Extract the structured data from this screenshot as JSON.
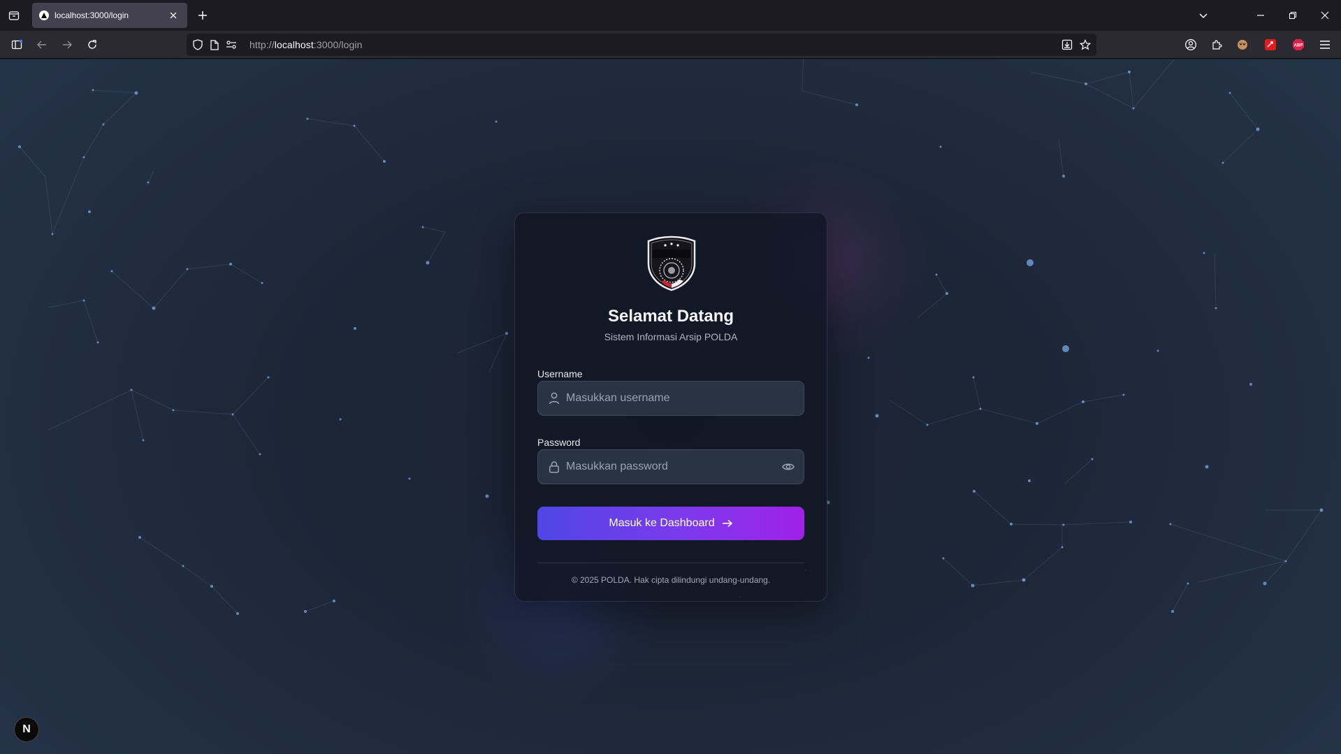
{
  "browser": {
    "tab_title": "localhost:3000/login",
    "url_prefix": "http://",
    "url_host": "localhost",
    "url_rest": ":3000/login"
  },
  "login": {
    "title": "Selamat Datang",
    "subtitle": "Sistem Informasi Arsip POLDA",
    "logo_text": "TIK POLRI",
    "username_label": "Username",
    "username_placeholder": "Masukkan username",
    "password_label": "Password",
    "password_placeholder": "Masukkan password",
    "submit_label": "Masuk ke Dashboard",
    "footer": "© 2025 POLDA. Hak cipta dilindungi undang-undang."
  },
  "dev_badge": "N",
  "colors": {
    "accent_start": "#4f46e5",
    "accent_end": "#a021e8",
    "page_bg": "#1d2637",
    "card_bg": "#111624"
  }
}
